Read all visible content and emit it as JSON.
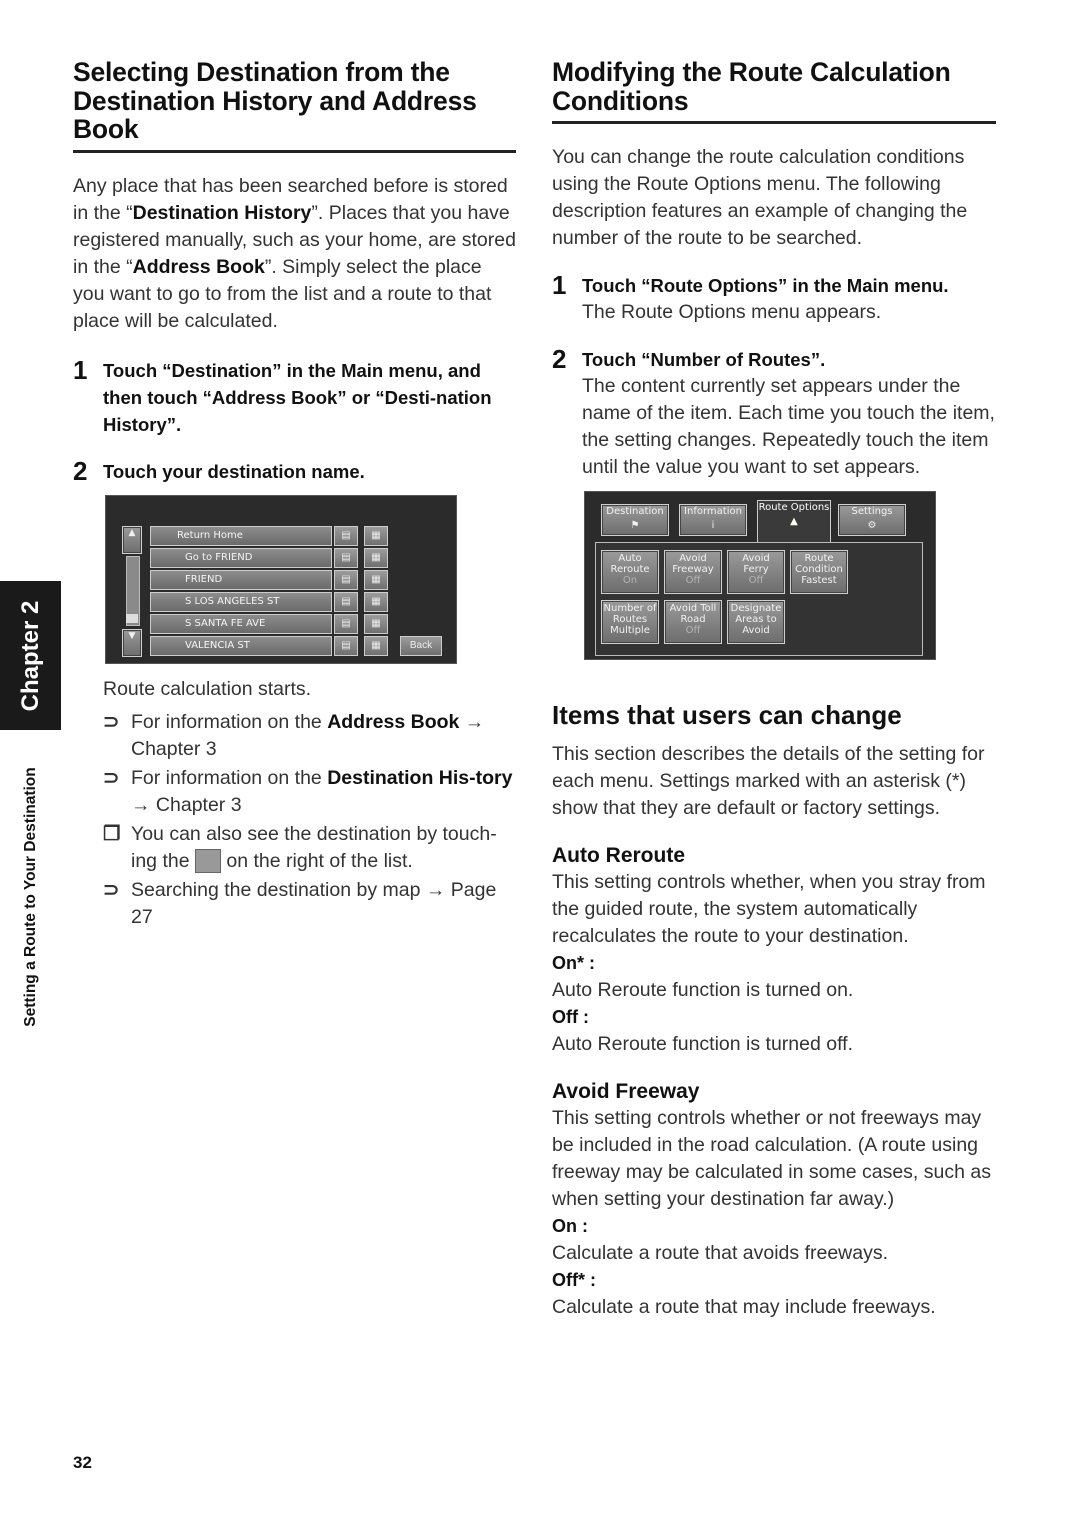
{
  "side": {
    "chapter_tab": "Chapter 2",
    "chapter_title": "Setting a Route to Your Destination"
  },
  "page_number": "32",
  "left": {
    "heading": "Selecting Destination from the Destination History and Address Book",
    "intro_parts": [
      "Any place that has been searched before is stored in the “",
      "Destination History",
      "”. Places that you have registered manually, such as your home, are stored in the “",
      "Address Book",
      "”. Simply select the place you want to go to from the list and a route to that place will be calculated."
    ],
    "steps": [
      {
        "num": "1",
        "title": "Touch “Destination” in the Main menu, and then touch “Address Book” or “Desti-nation History”."
      },
      {
        "num": "2",
        "title": "Touch your destination name."
      }
    ],
    "screen": {
      "items": [
        "Return Home",
        "Go to FRIEND",
        "FRIEND",
        "S LOS ANGELES ST",
        "S SANTA FE AVE",
        "VALENCIA ST"
      ],
      "back_label": "Back",
      "scroll_up": "▲",
      "scroll_down": "▼"
    },
    "after_screen": "Route calculation starts.",
    "bullets": [
      {
        "marker": "⊃",
        "pre": "For information on the ",
        "bold": "Address Book",
        "post": " → Chapter 3"
      },
      {
        "marker": "⊃",
        "pre": "For information on the ",
        "bold": "Destination His-tory",
        "post": " → Chapter 3"
      },
      {
        "marker": "❐",
        "pre": "You can also see the destination by touch-ing the ",
        "bold": "",
        "post": " on the right of the list."
      },
      {
        "marker": "⊃",
        "pre": "Searching the destination by map → Page 27",
        "bold": "",
        "post": ""
      }
    ]
  },
  "right": {
    "heading": "Modifying the Route Calculation Conditions",
    "intro": "You can change the route calculation conditions using the Route Options menu. The following description features an example of changing the number of the route to be searched.",
    "steps": [
      {
        "num": "1",
        "title": "Touch “Route Options” in the Main menu.",
        "body": "The Route Options menu appears."
      },
      {
        "num": "2",
        "title": "Touch “Number of Routes”.",
        "body": "The content currently set appears under the name of the item. Each time you touch the item, the setting changes. Repeatedly touch the item until the value you want to set appears."
      }
    ],
    "screen": {
      "tabs": [
        "Destination",
        "Information",
        "Route Options",
        "Settings"
      ],
      "buttons": [
        {
          "l1": "Auto",
          "l2": "Reroute",
          "val": "On"
        },
        {
          "l1": "Avoid",
          "l2": "Freeway",
          "val": "Off"
        },
        {
          "l1": "Avoid",
          "l2": "Ferry",
          "val": "Off"
        },
        {
          "l1": "Route",
          "l2": "Condition",
          "val": "Fastest"
        },
        {
          "l1": "Number of",
          "l2": "Routes",
          "val": "Multiple"
        },
        {
          "l1": "Avoid Toll",
          "l2": "Road",
          "val": "Off"
        },
        {
          "l1": "Designate",
          "l2": "Areas to",
          "val": "Avoid"
        }
      ]
    },
    "items_heading": "Items that users can change",
    "items_intro": "This section describes the details of the setting for each menu. Settings marked with an asterisk (*) show that they are default or factory settings.",
    "auto_reroute": {
      "title": "Auto Reroute",
      "desc": "This setting controls whether, when you stray from the guided route, the system automatically recalculates the route to your destination.",
      "options": [
        {
          "label": "On* :",
          "desc": "Auto Reroute function is turned on."
        },
        {
          "label": "Off :",
          "desc": "Auto Reroute function is turned off."
        }
      ]
    },
    "avoid_freeway": {
      "title": "Avoid Freeway",
      "desc": "This setting controls whether or not freeways may be included in the road calculation. (A route using freeway may be calculated in some cases, such as when setting your destination far away.)",
      "options": [
        {
          "label": "On :",
          "desc": "Calculate a route that avoids freeways."
        },
        {
          "label": "Off* :",
          "desc": "Calculate a route that may include freeways."
        }
      ]
    }
  }
}
